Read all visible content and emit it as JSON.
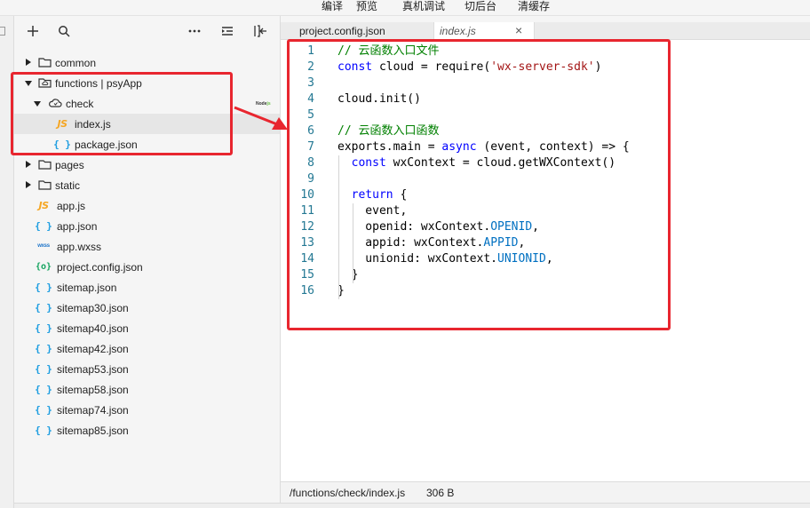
{
  "toolbar": {
    "items": [
      "编译",
      "预览",
      "真机调试",
      "切后台",
      "清缓存"
    ]
  },
  "explorer": {
    "tree": [
      {
        "label": "common",
        "kind": "folder"
      },
      {
        "label": "functions | psyApp",
        "kind": "cloud-folder"
      },
      {
        "label": "check",
        "kind": "cloud-function"
      },
      {
        "label": "index.js",
        "kind": "js",
        "icon_text": "JS"
      },
      {
        "label": "package.json",
        "kind": "json",
        "icon_text": "{ }"
      },
      {
        "label": "pages",
        "kind": "folder"
      },
      {
        "label": "static",
        "kind": "folder"
      },
      {
        "label": "app.js",
        "kind": "js",
        "icon_text": "JS"
      },
      {
        "label": "app.json",
        "kind": "json",
        "icon_text": "{ }"
      },
      {
        "label": "app.wxss",
        "kind": "wxss",
        "icon_text": "wxss"
      },
      {
        "label": "project.config.json",
        "kind": "config",
        "icon_text": "{o}"
      },
      {
        "label": "sitemap.json",
        "kind": "json",
        "icon_text": "{ }"
      },
      {
        "label": "sitemap30.json",
        "kind": "json",
        "icon_text": "{ }"
      },
      {
        "label": "sitemap40.json",
        "kind": "json",
        "icon_text": "{ }"
      },
      {
        "label": "sitemap42.json",
        "kind": "json",
        "icon_text": "{ }"
      },
      {
        "label": "sitemap53.json",
        "kind": "json",
        "icon_text": "{ }"
      },
      {
        "label": "sitemap58.json",
        "kind": "json",
        "icon_text": "{ }"
      },
      {
        "label": "sitemap74.json",
        "kind": "json",
        "icon_text": "{ }"
      },
      {
        "label": "sitemap85.json",
        "kind": "json",
        "icon_text": "{ }"
      }
    ],
    "nodejs_badge": {
      "prefix": "Node",
      "suffix": "js"
    }
  },
  "tabs": [
    {
      "label": "project.config.json",
      "active": false
    },
    {
      "label": "index.js",
      "active": true,
      "close_glyph": "×"
    }
  ],
  "editor": {
    "lines": [
      {
        "n": "1",
        "tokens": [
          {
            "t": "// 云函数入口文件",
            "c": "comment"
          }
        ]
      },
      {
        "n": "2",
        "tokens": [
          {
            "t": "const",
            "c": "kw"
          },
          {
            "t": " cloud = require(",
            "c": ""
          },
          {
            "t": "'wx-server-sdk'",
            "c": "str"
          },
          {
            "t": ")",
            "c": ""
          }
        ]
      },
      {
        "n": "3",
        "tokens": []
      },
      {
        "n": "4",
        "tokens": [
          {
            "t": "cloud.init()",
            "c": ""
          }
        ]
      },
      {
        "n": "5",
        "tokens": []
      },
      {
        "n": "6",
        "tokens": [
          {
            "t": "// 云函数入口函数",
            "c": "comment"
          }
        ]
      },
      {
        "n": "7",
        "tokens": [
          {
            "t": "exports.main = ",
            "c": ""
          },
          {
            "t": "async",
            "c": "kw"
          },
          {
            "t": " (event, context) => {",
            "c": ""
          }
        ]
      },
      {
        "n": "8",
        "tokens": [
          {
            "t": "  ",
            "c": ""
          },
          {
            "t": "const",
            "c": "kw"
          },
          {
            "t": " wxContext = cloud.getWXContext()",
            "c": ""
          }
        ]
      },
      {
        "n": "9",
        "tokens": []
      },
      {
        "n": "10",
        "tokens": [
          {
            "t": "  ",
            "c": ""
          },
          {
            "t": "return",
            "c": "kw"
          },
          {
            "t": " {",
            "c": ""
          }
        ]
      },
      {
        "n": "11",
        "tokens": [
          {
            "t": "    event,",
            "c": ""
          }
        ]
      },
      {
        "n": "12",
        "tokens": [
          {
            "t": "    openid: wxContext.",
            "c": ""
          },
          {
            "t": "OPENID",
            "c": "prop"
          },
          {
            "t": ",",
            "c": ""
          }
        ]
      },
      {
        "n": "13",
        "tokens": [
          {
            "t": "    appid: wxContext.",
            "c": ""
          },
          {
            "t": "APPID",
            "c": "prop"
          },
          {
            "t": ",",
            "c": ""
          }
        ]
      },
      {
        "n": "14",
        "tokens": [
          {
            "t": "    unionid: wxContext.",
            "c": ""
          },
          {
            "t": "UNIONID",
            "c": "prop"
          },
          {
            "t": ",",
            "c": ""
          }
        ]
      },
      {
        "n": "15",
        "tokens": [
          {
            "t": "  }",
            "c": ""
          }
        ]
      },
      {
        "n": "16",
        "tokens": [
          {
            "t": "}",
            "c": ""
          }
        ]
      }
    ]
  },
  "statusbar": {
    "path": "/functions/check/index.js",
    "size": "306 B"
  },
  "colors": {
    "annotation_red": "#e8262f",
    "keyword": "#0000ff",
    "comment": "#008000",
    "string": "#a31515",
    "line_number": "#237893"
  }
}
